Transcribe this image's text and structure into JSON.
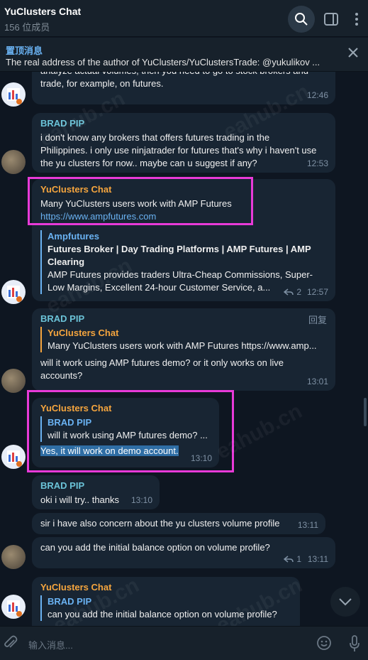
{
  "header": {
    "title": "YuClusters Chat",
    "member_count": "156 位成员",
    "icons": [
      "search-icon",
      "side-panel-icon",
      "more-vertical-icon"
    ]
  },
  "pinned": {
    "title": "置顶消息",
    "text": "The real address of the author of YuClusters/YuClustersTrade: @yukulikov ..."
  },
  "messages": [
    {
      "id": "m1",
      "text": "analyze actual volumes, then you need to go to stock brokers and trade, for example, on futures.",
      "time": "12:46"
    },
    {
      "id": "m2",
      "sender": "BRAD PIP",
      "text": "i don't know any brokers that offers futures trading in the Philippines. i only use ninjatrader for futures that's why i haven't use the yu clusters for now.. maybe can u suggest if any?",
      "time": "12:53"
    },
    {
      "id": "m3",
      "sender": "YuClusters Chat",
      "text": "Many YuClusters users work with AMP Futures",
      "link": "https://www.ampfutures.com",
      "preview_site": "Ampfutures",
      "preview_title": "Futures Broker | Day Trading Platforms | AMP Futures | AMP Clearing",
      "preview_desc": "AMP Futures provides traders Ultra-Cheap Commissions, Super-Low Margins, Excellent 24-hour Customer Service, a...",
      "replies": "2",
      "time": "12:57"
    },
    {
      "id": "m4",
      "sender": "BRAD PIP",
      "reply_label": "回复",
      "quote_name": "YuClusters Chat",
      "quote_text": "Many YuClusters users work with AMP Futures https://www.amp...",
      "text": "will it work using AMP futures demo? or it only works on live accounts?",
      "time": "13:01"
    },
    {
      "id": "m5",
      "sender": "YuClusters Chat",
      "quote_name": "BRAD PIP",
      "quote_text": "will it work using AMP futures demo? ...",
      "text": "Yes, it will work on demo account.",
      "time": "13:10"
    },
    {
      "id": "m6",
      "sender": "BRAD PIP",
      "text": "oki i will try.. thanks",
      "time": "13:10"
    },
    {
      "id": "m7",
      "text": "sir i have also concern about the yu clusters volume profile",
      "time": "13:11"
    },
    {
      "id": "m8",
      "text": "can you add the initial balance option on volume profile?",
      "replies": "1",
      "time": "13:11"
    },
    {
      "id": "m9",
      "sender": "YuClusters Chat",
      "quote_name": "BRAD PIP",
      "quote_text": "can you add the initial balance option on volume profile?"
    }
  ],
  "composer": {
    "placeholder": "输入消息...",
    "icons": [
      "attach-icon",
      "emoji-icon",
      "microphone-icon"
    ]
  },
  "watermarks": [
    "eahub.cn",
    "eahub.cn",
    "eahub.cn",
    "eahub.cn",
    "eahub.cn",
    "eahub.cn"
  ],
  "colors": {
    "background": "#0e1621",
    "bubble": "#182533",
    "accent": "#6ab2f2",
    "sender_orange": "#f5a53e",
    "sender_cyan": "#6bc3d8",
    "highlight_box": "#e83ad8"
  }
}
